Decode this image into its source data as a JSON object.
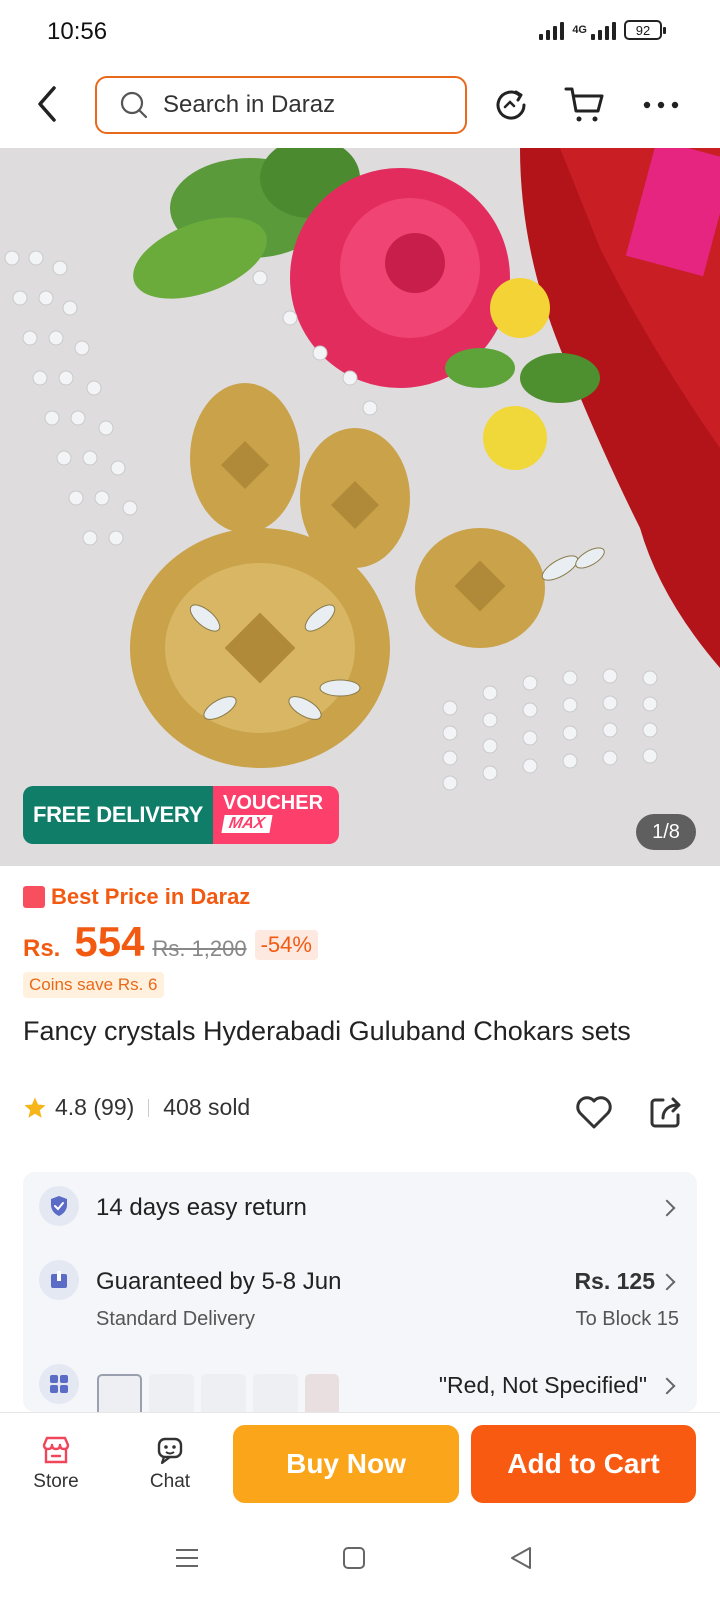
{
  "status_bar": {
    "time": "10:56",
    "network": "4G",
    "battery": "92"
  },
  "header": {
    "search_placeholder": "Search in Daraz"
  },
  "hero": {
    "badge_free": "FREE DELIVERY",
    "badge_voucher_top": "VOUCHER",
    "badge_voucher_bottom": "MAX",
    "counter": "1/8"
  },
  "pricing": {
    "best_price_label": "Best Price in Daraz",
    "currency": "Rs.",
    "price": "554",
    "old_price": "Rs. 1,200",
    "discount": "-54%",
    "coins": "Coins save Rs. 6"
  },
  "product": {
    "title": "Fancy crystals Hyderabadi Guluband Chokars sets",
    "rating": "4.8 (99)",
    "sold": "408 sold"
  },
  "services": {
    "return": "14 days easy return",
    "delivery": "Guaranteed by 5-8 Jun",
    "delivery_type": "Standard Delivery",
    "delivery_price": "Rs. 125",
    "delivery_location": "To Block 15",
    "variant": "\"Red, Not Specified\""
  },
  "bottom_bar": {
    "store_label": "Store",
    "chat_label": "Chat",
    "buy_now_label": "Buy Now",
    "add_to_cart_label": "Add to Cart"
  },
  "colors": {
    "accent": "#f85a12",
    "buy_now": "#faa51a",
    "free_delivery": "#0f7d68",
    "voucher": "#fc3f6b"
  }
}
